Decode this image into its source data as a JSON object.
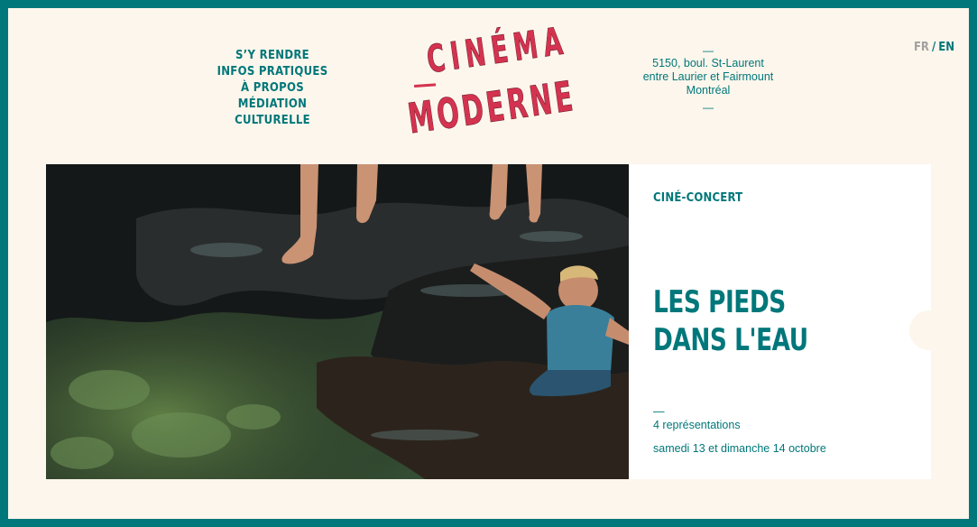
{
  "nav": {
    "items": [
      {
        "label": "S’Y RENDRE"
      },
      {
        "label": "INFOS PRATIQUES"
      },
      {
        "label": "À PROPOS"
      },
      {
        "label": "MÉDIATION CULTURELLE"
      }
    ]
  },
  "logo": {
    "line1": "CINÉMA",
    "line2": "MODERNE"
  },
  "address": {
    "dash_top": "—",
    "line1": "5150, boul. St-Laurent",
    "line2": "entre Laurier et Fairmount",
    "line3": "Montréal",
    "dash_bottom": "—"
  },
  "lang": {
    "fr": "FR",
    "separator": "/",
    "en": "EN"
  },
  "hero": {
    "category": "CINÉ-CONCERT",
    "title": "LES PIEDS DANS L'EAU",
    "dash": "—",
    "screenings": "4 représentations",
    "dates": "samedi 13 et dimanche 14 octobre"
  },
  "colors": {
    "accent": "#00777a",
    "logo": "#d4334f",
    "background": "#fdf6ec"
  }
}
